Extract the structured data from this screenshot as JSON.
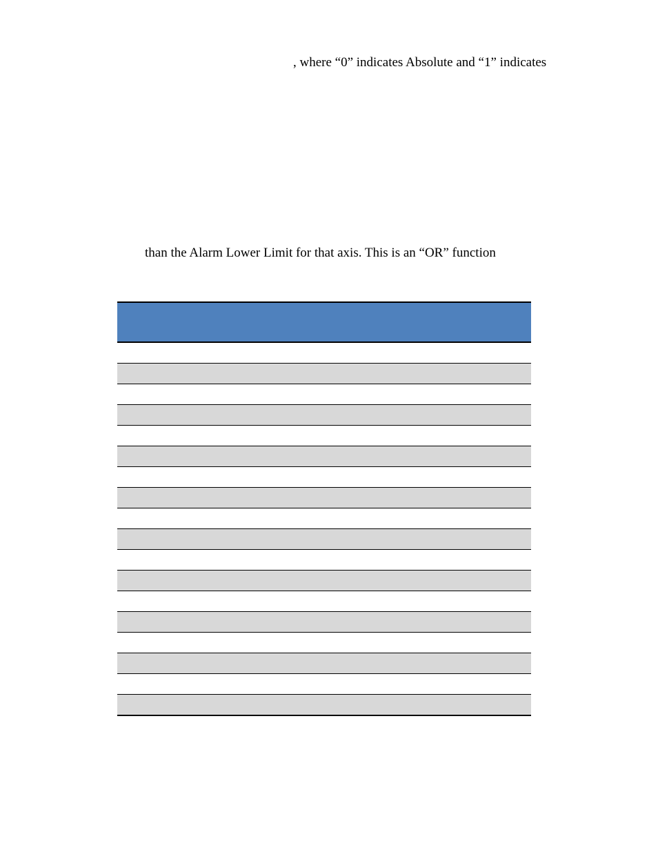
{
  "fragments": {
    "top": ", where “0” indicates Absolute and “1” indicates",
    "mid": "than the Alarm Lower Limit for that axis.  This is an “OR” function"
  },
  "table": {
    "header_bg": "#4f81bd",
    "alt_row_bg": "#d8d8d8",
    "columns": [
      "",
      "",
      "",
      ""
    ],
    "rows": [
      [
        "",
        "",
        "",
        ""
      ],
      [
        "",
        "",
        "",
        ""
      ],
      [
        "",
        "",
        "",
        ""
      ],
      [
        "",
        "",
        "",
        ""
      ],
      [
        "",
        "",
        "",
        ""
      ],
      [
        "",
        "",
        "",
        ""
      ],
      [
        "",
        "",
        "",
        ""
      ],
      [
        "",
        "",
        "",
        ""
      ],
      [
        "",
        "",
        "",
        ""
      ],
      [
        "",
        "",
        "",
        ""
      ],
      [
        "",
        "",
        "",
        ""
      ],
      [
        "",
        "",
        "",
        ""
      ],
      [
        "",
        "",
        "",
        ""
      ],
      [
        "",
        "",
        "",
        ""
      ],
      [
        "",
        "",
        "",
        ""
      ],
      [
        "",
        "",
        "",
        ""
      ],
      [
        "",
        "",
        "",
        ""
      ],
      [
        "",
        "",
        "",
        ""
      ]
    ]
  }
}
